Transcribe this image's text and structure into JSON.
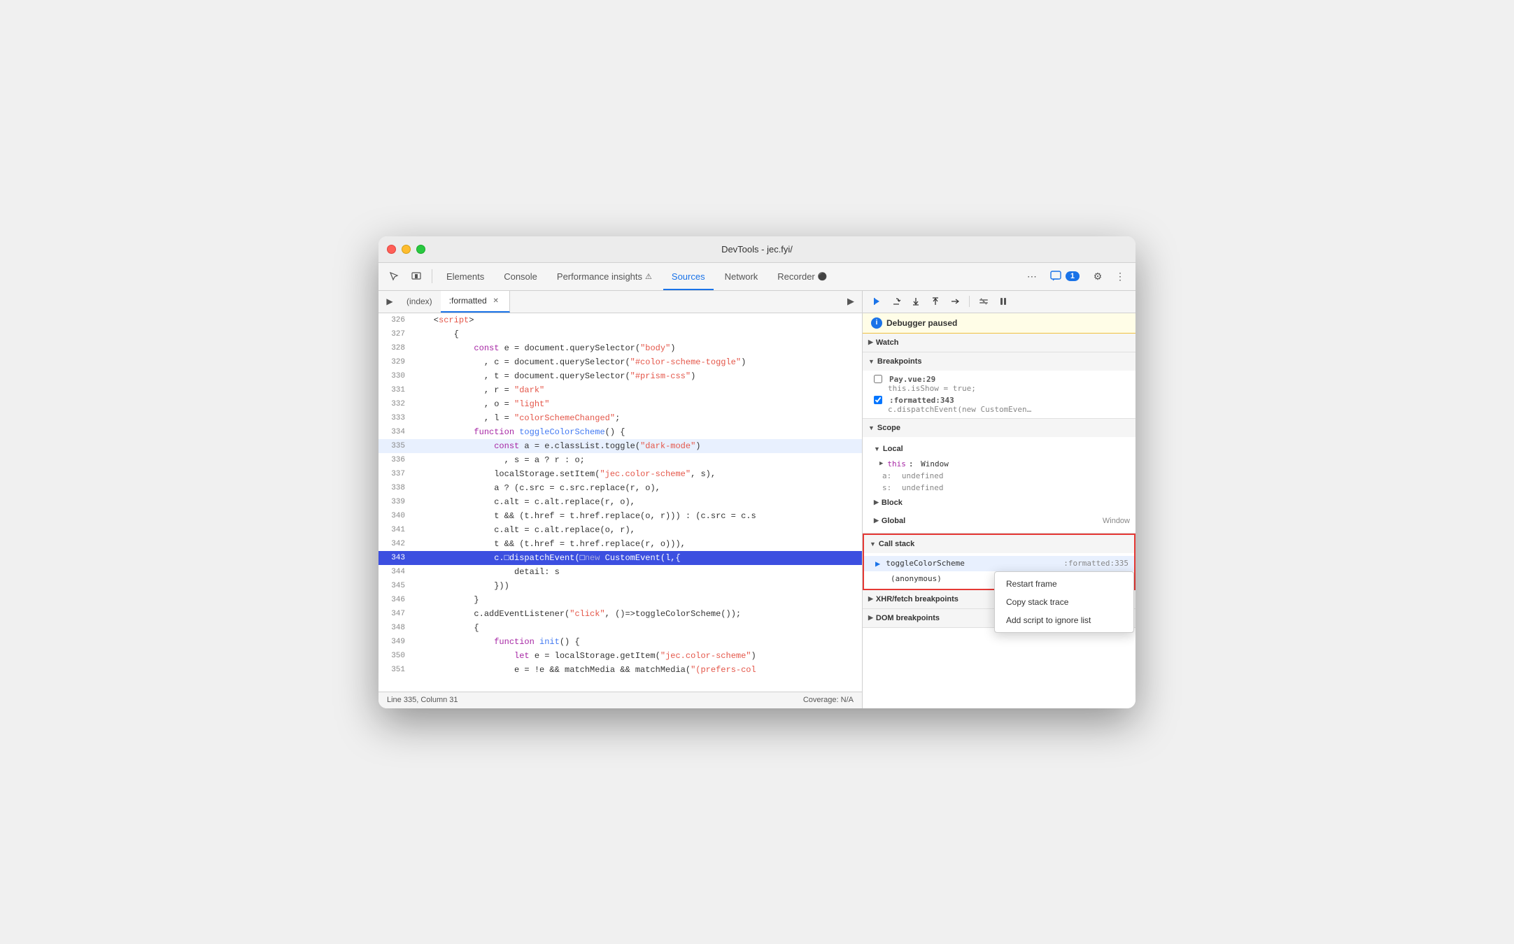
{
  "window": {
    "title": "DevTools - jec.fyi/"
  },
  "toolbar": {
    "tabs": [
      {
        "id": "elements",
        "label": "Elements",
        "active": false
      },
      {
        "id": "console",
        "label": "Console",
        "active": false
      },
      {
        "id": "performance",
        "label": "Performance insights",
        "icon": "⚠",
        "active": false
      },
      {
        "id": "sources",
        "label": "Sources",
        "active": true
      },
      {
        "id": "network",
        "label": "Network",
        "active": false
      },
      {
        "id": "recorder",
        "label": "Recorder",
        "icon": "⚫",
        "active": false
      }
    ],
    "badge": "1",
    "more_label": "⋯"
  },
  "code_panel": {
    "tabs": [
      {
        "id": "index",
        "label": "(index)",
        "closeable": false
      },
      {
        "id": "formatted",
        "label": ":formatted",
        "closeable": true,
        "active": true
      }
    ],
    "lines": [
      {
        "num": 326,
        "code": "    <script>"
      },
      {
        "num": 327,
        "code": "        {"
      },
      {
        "num": 328,
        "code": "            const e = document.querySelector(\"body\")"
      },
      {
        "num": 329,
        "code": "              , c = document.querySelector(\"#color-scheme-toggle\")"
      },
      {
        "num": 330,
        "code": "              , t = document.querySelector(\"#prism-css\")"
      },
      {
        "num": 331,
        "code": "              , r = \"dark\""
      },
      {
        "num": 332,
        "code": "              , o = \"light\""
      },
      {
        "num": 333,
        "code": "              , l = \"colorSchemeChanged\";"
      },
      {
        "num": 334,
        "code": "            function toggleColorScheme() {"
      },
      {
        "num": 335,
        "code": "                const a = e.classList.toggle(\"dark-mode\")",
        "highlighted": true
      },
      {
        "num": 336,
        "code": "                  , s = a ? r : o;"
      },
      {
        "num": 337,
        "code": "                localStorage.setItem(\"jec.color-scheme\", s),"
      },
      {
        "num": 338,
        "code": "                a ? (c.src = c.src.replace(r, o),"
      },
      {
        "num": 339,
        "code": "                c.alt = c.alt.replace(r, o),"
      },
      {
        "num": 340,
        "code": "                t && (t.href = t.href.replace(o, r))) : (c.src = c.s"
      },
      {
        "num": 341,
        "code": "                c.alt = c.alt.replace(o, r),"
      },
      {
        "num": 342,
        "code": "                t && (t.href = t.href.replace(r, o))),"
      },
      {
        "num": 343,
        "code": "                c.dispatchEvent(new CustomEvent(l,{",
        "breakpoint": true
      },
      {
        "num": 344,
        "code": "                    detail: s"
      },
      {
        "num": 345,
        "code": "                }))"
      },
      {
        "num": 346,
        "code": "            }"
      },
      {
        "num": 347,
        "code": "            c.addEventListener(\"click\", ()=>toggleColorScheme());"
      },
      {
        "num": 348,
        "code": "            {"
      },
      {
        "num": 349,
        "code": "                function init() {"
      },
      {
        "num": 350,
        "code": "                    let e = localStorage.getItem(\"jec.color-scheme\")"
      },
      {
        "num": 351,
        "code": "                    e = !e && matchMedia && matchMedia(\"(prefers-col"
      }
    ],
    "status": {
      "line_col": "Line 335, Column 31",
      "coverage": "Coverage: N/A"
    }
  },
  "right_panel": {
    "debug_toolbar": {
      "buttons": [
        {
          "id": "resume",
          "icon": "▶",
          "label": "Resume"
        },
        {
          "id": "step-over",
          "icon": "↻",
          "label": "Step over"
        },
        {
          "id": "step-into",
          "icon": "↓",
          "label": "Step into"
        },
        {
          "id": "step-out",
          "icon": "↑",
          "label": "Step out"
        },
        {
          "id": "step",
          "icon": "→",
          "label": "Step"
        },
        {
          "id": "deactivate",
          "icon": "◎",
          "label": "Deactivate breakpoints"
        },
        {
          "id": "pause",
          "icon": "⏸",
          "label": "Pause on exceptions"
        }
      ]
    },
    "debugger_paused": "Debugger paused",
    "sections": {
      "watch": {
        "label": "Watch",
        "expanded": false
      },
      "breakpoints": {
        "label": "Breakpoints",
        "expanded": true,
        "items": [
          {
            "id": "bp1",
            "file": "Pay.vue:29",
            "code": "this.isShow = true;",
            "checked": false
          },
          {
            "id": "bp2",
            "file": ":formatted:343",
            "code": "c.dispatchEvent(new CustomEven…",
            "checked": true
          }
        ]
      },
      "scope": {
        "label": "Scope",
        "expanded": true,
        "local": {
          "label": "Local",
          "expanded": true,
          "items": [
            {
              "key": "▶ this",
              "val": "Window",
              "type": "object"
            },
            {
              "key": "a:",
              "val": "undefined",
              "type": "undefined"
            },
            {
              "key": "s:",
              "val": "undefined",
              "type": "undefined"
            }
          ]
        },
        "block": {
          "label": "Block",
          "expanded": false
        },
        "global": {
          "label": "Global",
          "expanded": false,
          "val": "Window"
        }
      },
      "callstack": {
        "label": "Call stack",
        "expanded": true,
        "items": [
          {
            "id": "cs1",
            "name": "toggleColorScheme",
            "loc": ":formatted:335",
            "active": true
          },
          {
            "id": "cs2",
            "name": "(anonymous)",
            "loc": "",
            "active": false
          }
        ]
      },
      "xhr": {
        "label": "XHR/fetch breakpoints",
        "expanded": false
      },
      "dom": {
        "label": "DOM breakpoints",
        "expanded": false
      }
    },
    "context_menu": {
      "items": [
        {
          "id": "restart-frame",
          "label": "Restart frame"
        },
        {
          "id": "copy-stack-trace",
          "label": "Copy stack trace"
        },
        {
          "id": "add-to-ignore",
          "label": "Add script to ignore list"
        }
      ]
    }
  }
}
